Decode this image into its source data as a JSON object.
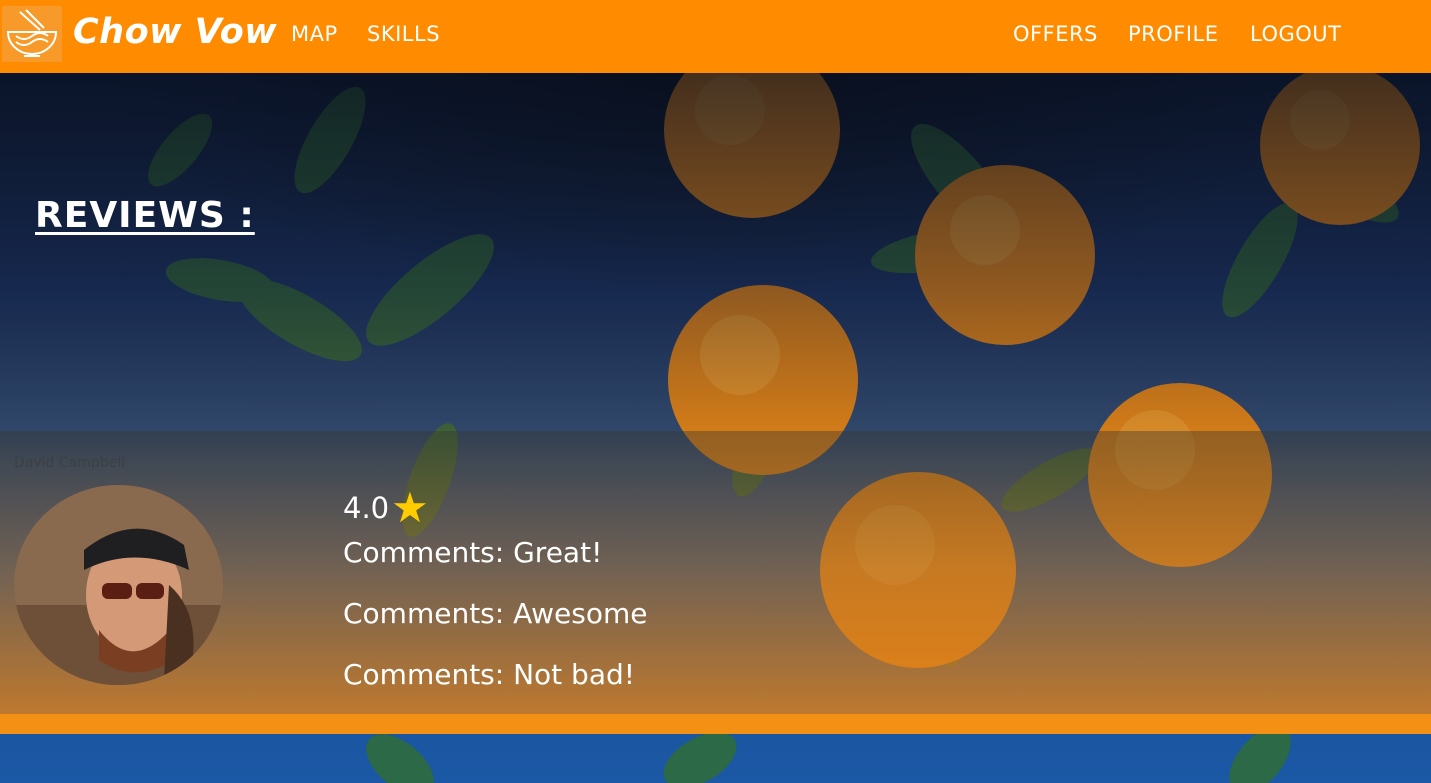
{
  "header": {
    "brand": "Chow Vow",
    "logo_icon": "noodle-bowl-icon",
    "nav_left": [
      {
        "label": "MAP"
      },
      {
        "label": "SKILLS"
      }
    ],
    "nav_right": [
      {
        "label": "OFFERS"
      },
      {
        "label": "PROFILE"
      },
      {
        "label": "LOGOUT"
      }
    ]
  },
  "main": {
    "title": "REVIEWS :",
    "review": {
      "reviewer_name": "David Campbell",
      "rating": "4.0",
      "star_icon": "star-icon",
      "comments": [
        "Comments: Great!",
        "Comments: Awesome",
        "Comments: Not bad!"
      ]
    }
  },
  "colors": {
    "navbar": "#ff8c00",
    "accent_star": "#ffcc00",
    "strip": "#f49013"
  }
}
